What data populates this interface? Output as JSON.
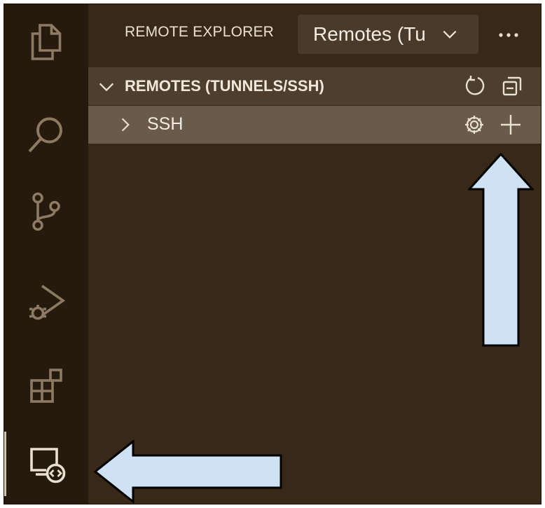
{
  "activity_bar": {
    "items": [
      {
        "name": "explorer",
        "icon": "files-icon"
      },
      {
        "name": "search",
        "icon": "search-icon"
      },
      {
        "name": "source-control",
        "icon": "source-control-icon"
      },
      {
        "name": "run-and-debug",
        "icon": "run-debug-icon"
      },
      {
        "name": "extensions",
        "icon": "extensions-icon"
      },
      {
        "name": "remote-explorer",
        "icon": "remote-explorer-icon",
        "active": true
      }
    ]
  },
  "header": {
    "title": "REMOTE EXPLORER",
    "dropdown_value": "Remotes (Tu",
    "more_icon": "ellipsis-icon"
  },
  "section": {
    "title": "REMOTES (TUNNELS/SSH)",
    "actions": [
      "refresh-icon",
      "collapse-all-icon"
    ]
  },
  "tree": {
    "items": [
      {
        "label": "SSH",
        "actions": [
          "gear-icon",
          "plus-icon"
        ]
      }
    ]
  },
  "annotations": {
    "arrow_color": "#cfe2f3",
    "arrows": [
      "up-arrow-pointing-to-plus",
      "left-arrow-pointing-to-remote-explorer"
    ]
  },
  "colors": {
    "sidebar_bg": "#382818",
    "activity_bg": "#261a0e",
    "section_bg": "#4e3e2e",
    "row_bg": "#6a5a4a",
    "icon_color": "#8e7a63",
    "text_color": "#f0e8dc"
  }
}
